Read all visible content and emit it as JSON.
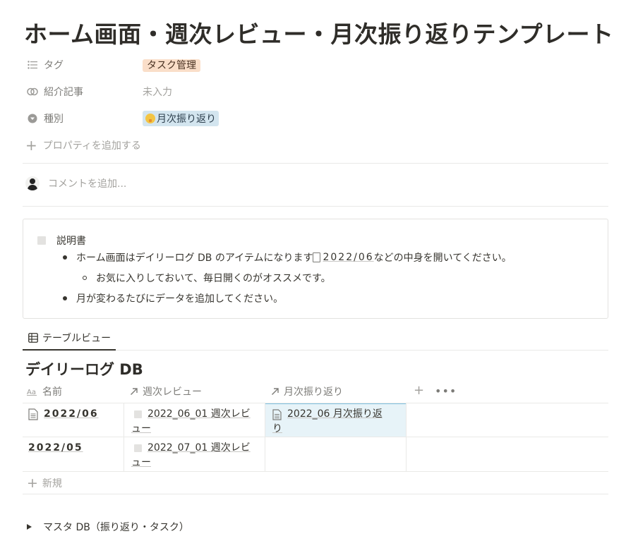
{
  "page": {
    "title": "ホーム画面・週次レビュー・月次振り返りテンプレート"
  },
  "properties": [
    {
      "icon": "list-icon",
      "label": "タグ",
      "value": "タスク管理",
      "style": "tag-orange"
    },
    {
      "icon": "relation-icon",
      "label": "紹介記事",
      "value": "未入力",
      "style": "empty"
    },
    {
      "icon": "select-icon",
      "label": "種別",
      "value": "月次振り返り",
      "style": "tag-blue"
    }
  ],
  "add_property_label": "プロパティを追加する",
  "comment_placeholder": "コメントを追加...",
  "callout": {
    "title": "説明書",
    "bullet1_before": "ホーム画面はデイリーログ DB のアイテムになります ",
    "bullet1_link": "2022/06",
    "bullet1_after": " などの中身を開いてください。",
    "sub_bullet": "お気に入りしておいて、毎日開くのがオススメです。",
    "bullet2": "月が変わるたびにデータを追加してください。"
  },
  "view_tab": "テーブルビュー",
  "database": {
    "title": "デイリーログ DB",
    "columns": [
      {
        "icon": "text-icon",
        "label": "名前"
      },
      {
        "icon": "relation-arrow-icon",
        "label": "週次レビュー"
      },
      {
        "icon": "relation-arrow-icon",
        "label": "月次振り返り"
      }
    ],
    "rows": [
      {
        "name": "2022/06",
        "weekly_line1": "2022_06_01 週次レビ",
        "weekly_line2": "ュー",
        "monthly_line1": "2022_06 月次振り返",
        "monthly_line2": "り"
      },
      {
        "name": "2022/05",
        "weekly_line1": "2022_07_01 週次レビ",
        "weekly_line2": "ュー",
        "monthly_line1": "",
        "monthly_line2": ""
      }
    ],
    "new_label": "新規"
  },
  "toggle_label": "マスタ DB（振り返り・タスク）"
}
